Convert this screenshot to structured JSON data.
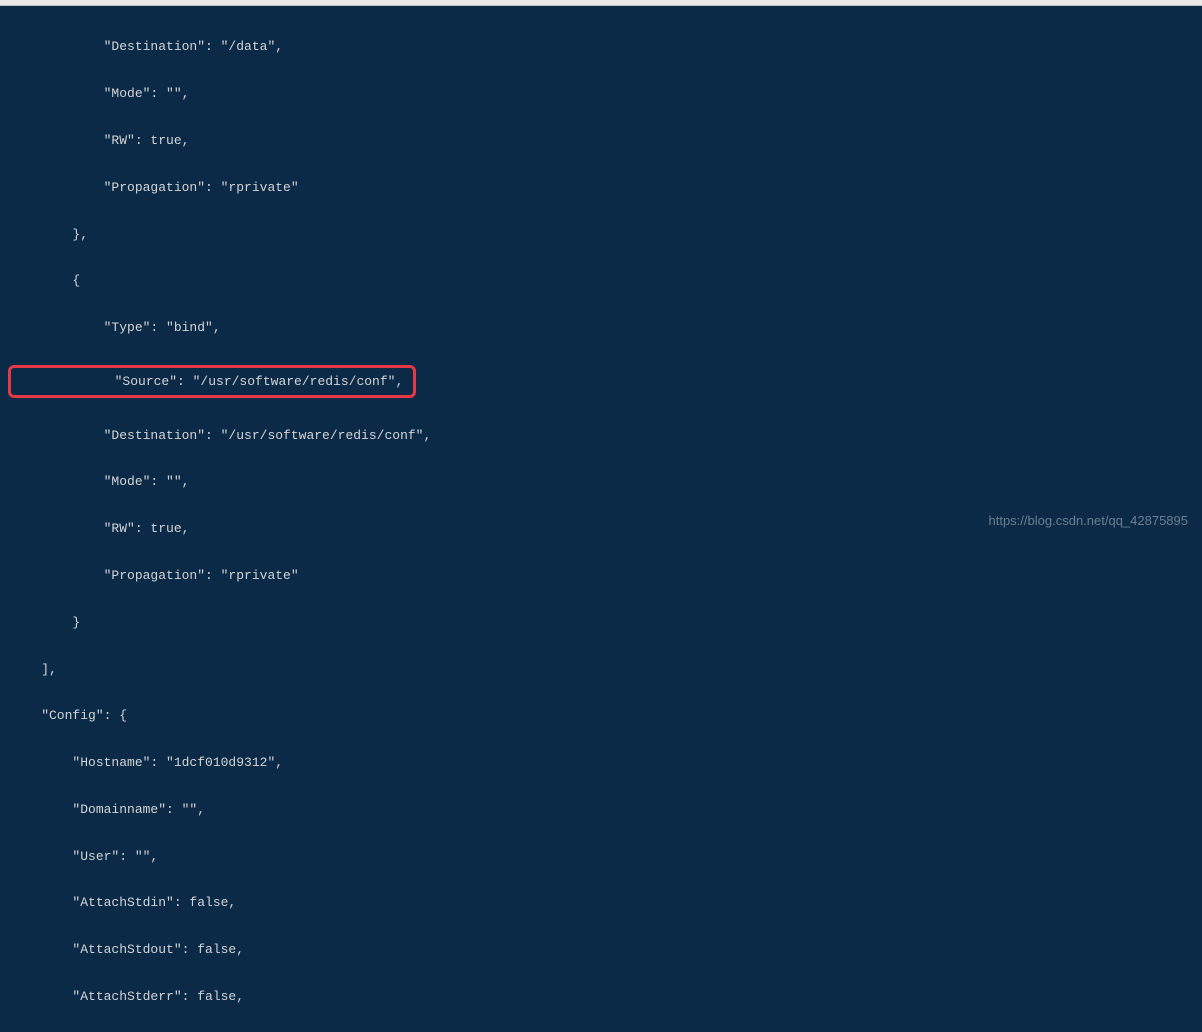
{
  "lines": {
    "l1": "            \"Destination\": \"/data\",",
    "l2": "            \"Mode\": \"\",",
    "l3": "            \"RW\": true,",
    "l4": "            \"Propagation\": \"rprivate\"",
    "l5": "        },",
    "l6": "        {",
    "l7": "            \"Type\": \"bind\",",
    "l8": "            \"Source\": \"/usr/software/redis/conf\",",
    "l9": "            \"Destination\": \"/usr/software/redis/conf\",",
    "l10": "            \"Mode\": \"\",",
    "l11": "            \"RW\": true,",
    "l12": "            \"Propagation\": \"rprivate\"",
    "l13": "        }",
    "l14": "    ],",
    "l15": "    \"Config\": {",
    "l16": "        \"Hostname\": \"1dcf010d9312\",",
    "l17": "        \"Domainname\": \"\",",
    "l18": "        \"User\": \"\",",
    "l19": "        \"AttachStdin\": false,",
    "l20": "        \"AttachStdout\": false,",
    "l21": "        \"AttachStderr\": false,"
  },
  "watermark": "https://blog.csdn.net/qq_42875895"
}
